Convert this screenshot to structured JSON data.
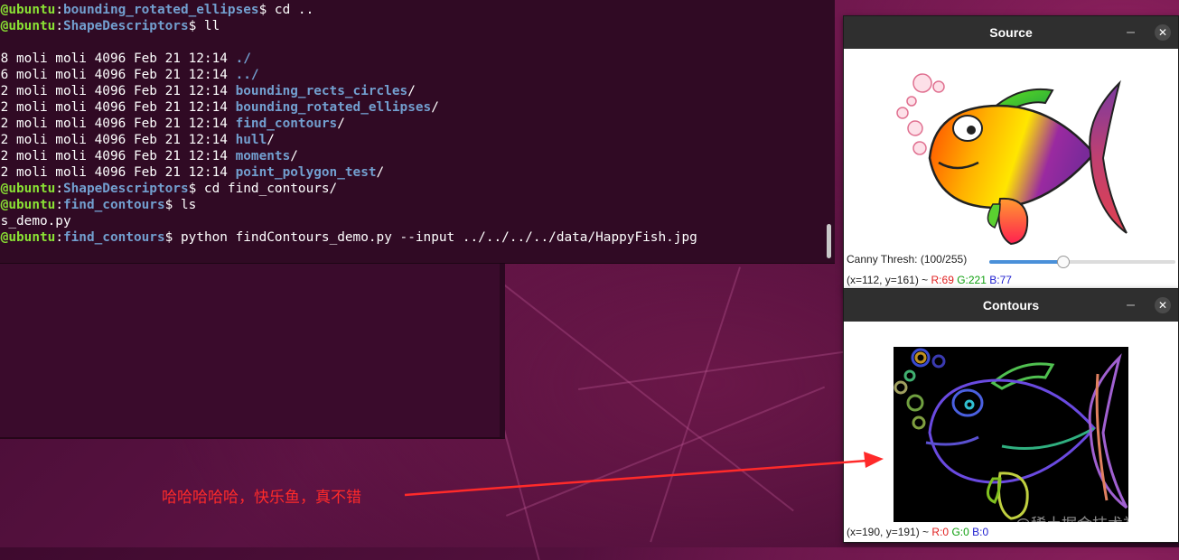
{
  "terminal": {
    "prompt_user": ".@ubuntu",
    "lines": [
      {
        "path": "bounding_rotated_ellipses",
        "cmd": " cd .."
      },
      {
        "path": "ShapeDescriptors",
        "cmd": " ll"
      },
      {
        "text": ""
      },
      {
        "perm": "8 moli moli 4096 Feb 21 12:14 ",
        "name": "./"
      },
      {
        "perm": "6 moli moli 4096 Feb 21 12:14 ",
        "name": "../"
      },
      {
        "perm": "2 moli moli 4096 Feb 21 12:14 ",
        "name": "bounding_rects_circles",
        "suffix": "/"
      },
      {
        "perm": "2 moli moli 4096 Feb 21 12:14 ",
        "name": "bounding_rotated_ellipses",
        "suffix": "/"
      },
      {
        "perm": "2 moli moli 4096 Feb 21 12:14 ",
        "name": "find_contours",
        "suffix": "/"
      },
      {
        "perm": "2 moli moli 4096 Feb 21 12:14 ",
        "name": "hull",
        "suffix": "/"
      },
      {
        "perm": "2 moli moli 4096 Feb 21 12:14 ",
        "name": "moments",
        "suffix": "/"
      },
      {
        "perm": "2 moli moli 4096 Feb 21 12:14 ",
        "name": "point_polygon_test",
        "suffix": "/"
      },
      {
        "path": "ShapeDescriptors",
        "cmd": " cd find_contours/"
      },
      {
        "path": "find_contours",
        "cmd": " ls"
      },
      {
        "text": "s_demo.py"
      },
      {
        "path": "find_contours",
        "cmd": " python findContours_demo.py --input ../../../../data/HappyFish.jpg"
      }
    ]
  },
  "source_window": {
    "title": "Source",
    "min_label": "–",
    "close_label": "✕",
    "trackbar_label": "Canny Thresh: (100/255)",
    "trackbar_value": 100,
    "trackbar_max": 255,
    "status_prefix": "(x=112, y=161) ~ ",
    "status_r": "R:69",
    "status_g": "G:221",
    "status_b": "B:77"
  },
  "contours_window": {
    "title": "Contours",
    "min_label": "–",
    "close_label": "✕",
    "status_prefix": "(x=190, y=191) ~ ",
    "status_r": "R:0",
    "status_g": "G:0",
    "status_b": "B:0"
  },
  "annotation": {
    "text": "哈哈哈哈哈，快乐鱼，真不错",
    "color": "#ff2a2a"
  },
  "watermark": "@稀土掘金技术社区",
  "colors": {
    "terminal_bg": "#300a24",
    "prompt_user": "#8ae234",
    "prompt_path": "#729fcf",
    "titlebar": "#2f2f2f"
  }
}
